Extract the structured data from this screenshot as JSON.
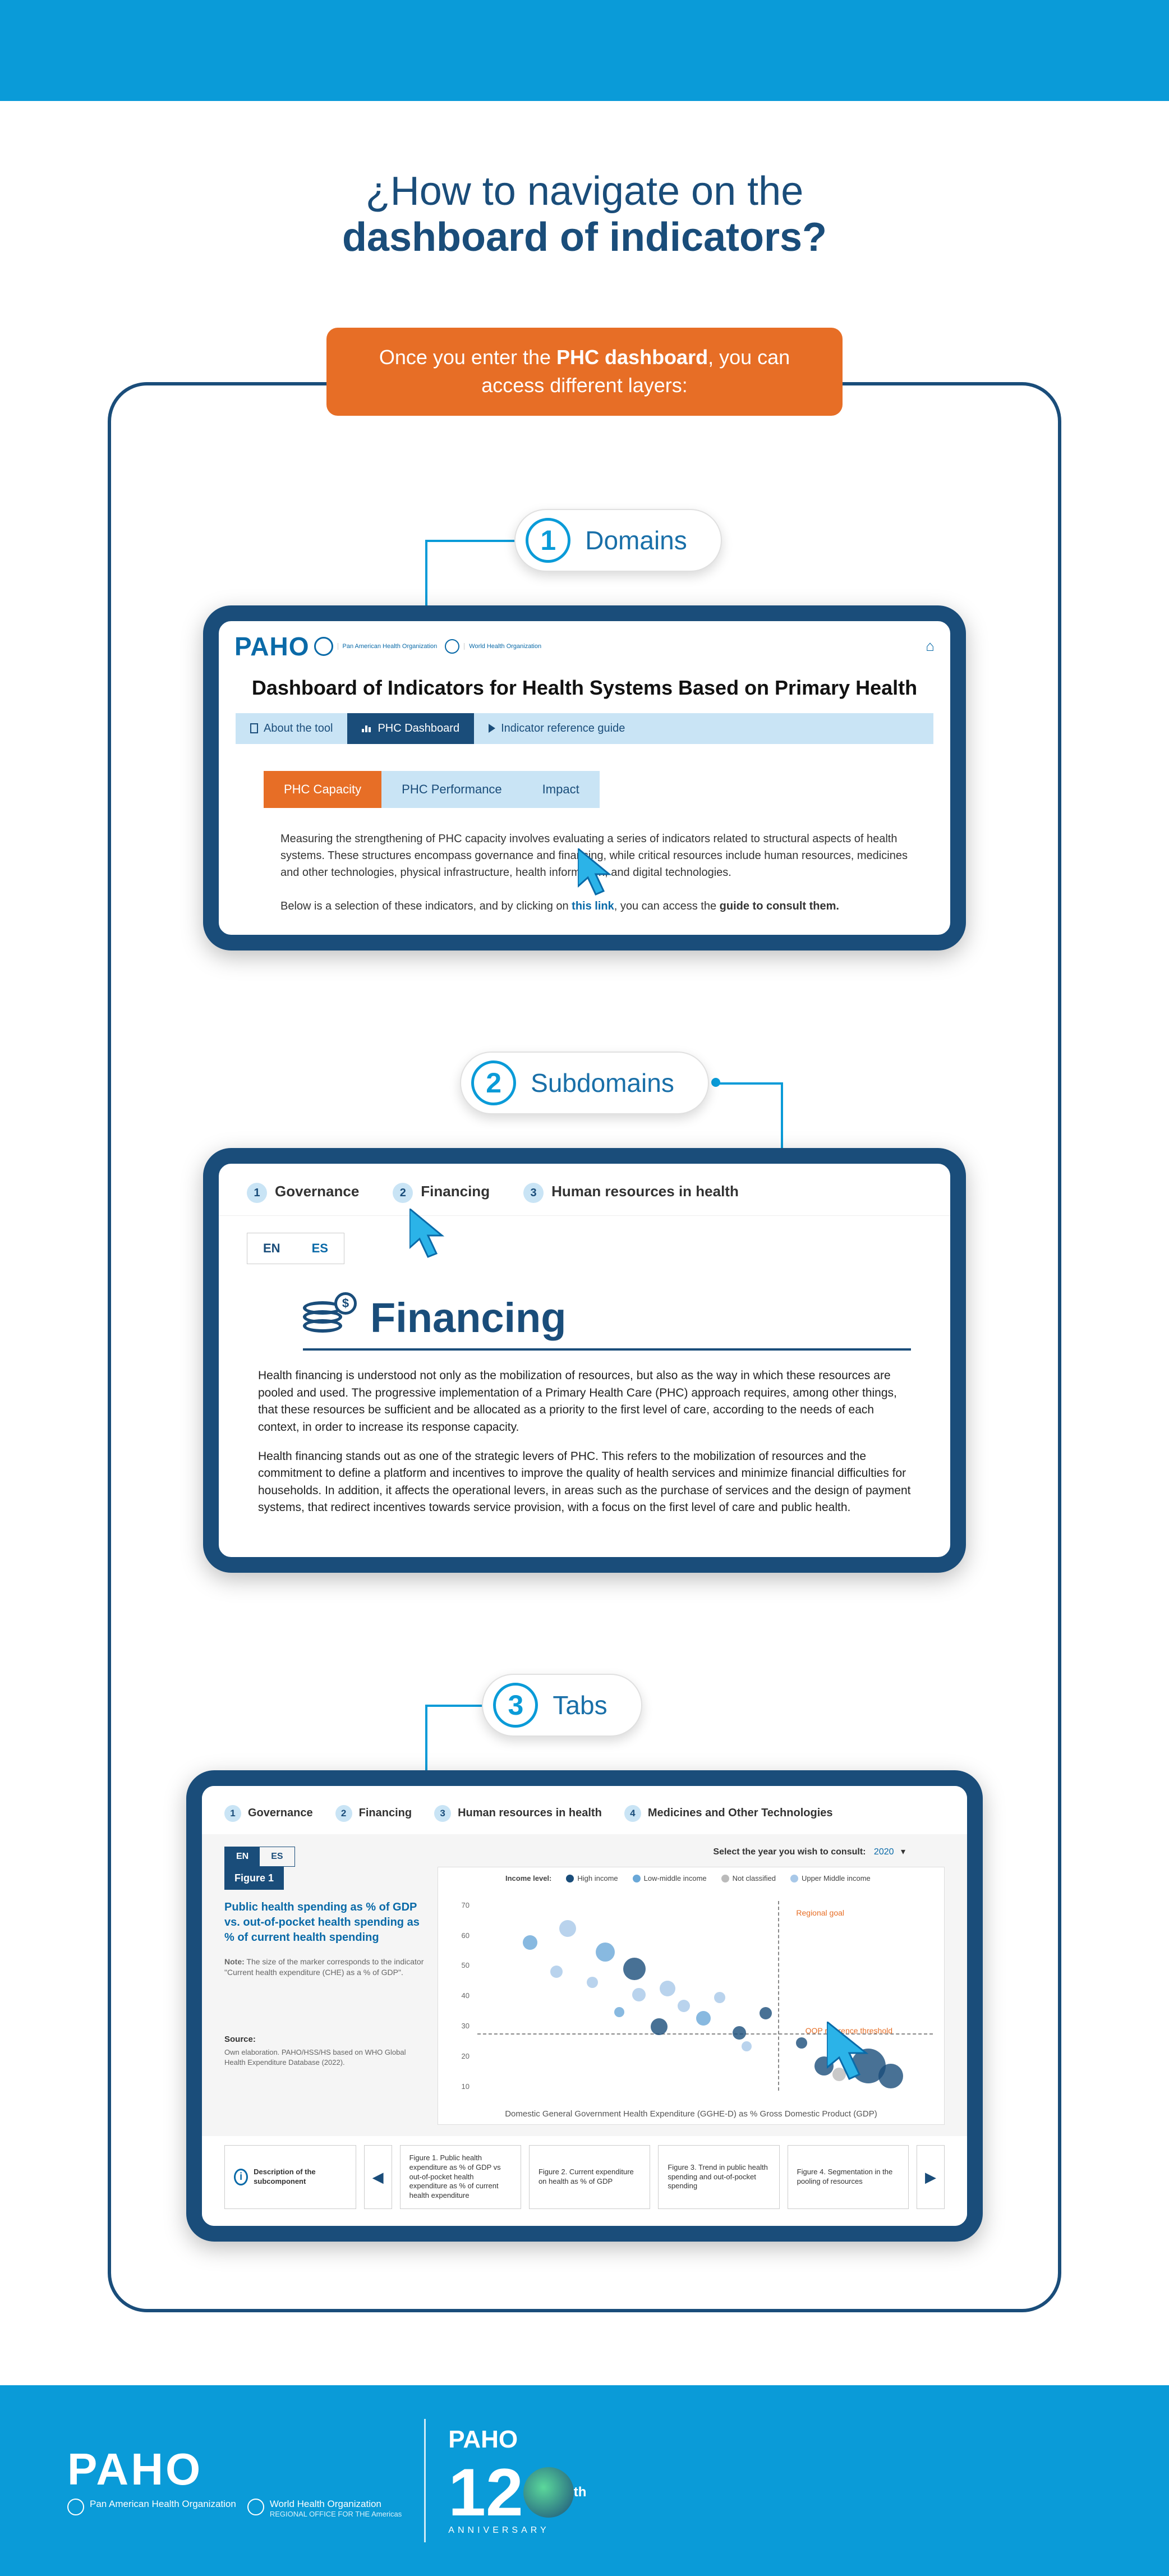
{
  "title": {
    "line1": "¿How to navigate on the",
    "line2": "dashboard of indicators?"
  },
  "intro": {
    "prefix": "Once you enter the ",
    "bold": "PHC dashboard",
    "suffix": ", you can access different layers:"
  },
  "steps": {
    "s1": {
      "num": "1",
      "label": "Domains"
    },
    "s2": {
      "num": "2",
      "label": "Subdomains"
    },
    "s3": {
      "num": "3",
      "label": "Tabs"
    }
  },
  "ss1": {
    "logo_word": "PAHO",
    "logo_sub1": "Pan American Health Organization",
    "logo_sub2": "World Health Organization",
    "title": "Dashboard of Indicators for Health Systems Based on Primary Health",
    "tab_about": "About the tool",
    "tab_dash": "PHC Dashboard",
    "tab_ref": "Indicator reference guide",
    "pill_capacity": "PHC Capacity",
    "pill_perf": "PHC Performance",
    "pill_impact": "Impact",
    "para1": "Measuring the strengthening of PHC capacity involves evaluating a series of indicators related to structural aspects of health systems. These structures encompass governance and financing, while critical resources include human resources, medicines and other technologies, physical infrastructure, health information, and digital technologies.",
    "para2_pre": "Below is a selection of these indicators, and by clicking on ",
    "para2_link": "this link",
    "para2_mid": ", you can access the ",
    "para2_bold": "guide to consult them."
  },
  "ss2": {
    "sub1": "Governance",
    "sub2": "Financing",
    "sub3": "Human resources in health",
    "lang_en": "EN",
    "lang_es": "ES",
    "heading": "Financing",
    "p1": "Health financing is understood not only as the mobilization of resources, but also as the way in which these resources are pooled and used. The progressive implementation of a Primary Health Care (PHC) approach requires, among other things, that these resources be sufficient and be allocated as a priority to the first level of care, according to the needs of each context, in order to increase its response capacity.",
    "p2": "Health financing stands out as one of the strategic levers of PHC. This refers to the mobilization of resources and the commitment to define a platform and incentives to improve the quality of health services and minimize financial difficulties for households. In addition, it affects the operational levers, in areas such as the purchase of services and the design of payment systems, that redirect incentives towards service provision, with a focus on the first level of care and public health."
  },
  "ss3": {
    "sub1": "Governance",
    "sub2": "Financing",
    "sub3": "Human resources in health",
    "sub4": "Medicines and Other Technologies",
    "lang_en": "EN",
    "lang_es": "ES",
    "year_label": "Select the year you wish to consult:",
    "year": "2020",
    "fig_label": "Figure 1",
    "fig_title": "Public health spending as % of GDP vs. out-of-pocket health spending as % of current health spending",
    "note_label": "Note:",
    "note": "The size of the marker corresponds to the indicator \"Current health expenditure (CHE) as a % of GDP\".",
    "source_h": "Source:",
    "source": "Own elaboration. PAHO/HSS/HS based on WHO Global Health Expenditure Database (2022).",
    "legend_label": "Income level:",
    "leg1": "High income",
    "leg2": "Low-middle income",
    "leg3": "Not classified",
    "leg4": "Upper Middle income",
    "ann_goal": "Regional goal",
    "ann_ref": "OOP reference threshold",
    "x_label": "Domestic General Government Health Expenditure (GGHE-D) as % Gross Domestic Product (GDP)",
    "y_ticks": [
      "70",
      "60",
      "50",
      "40",
      "30",
      "20",
      "10"
    ],
    "card_desc": "Description of the subcomponent",
    "card1": "Figure 1. Public health expenditure as % of GDP vs out-of-pocket health expenditure as % of current health expenditure",
    "card2": "Figure 2. Current expenditure on health as % of GDP",
    "card3": "Figure 3. Trend in public health spending and out-of-pocket spending",
    "card4": "Figure 4. Segmentation in the pooling of resources"
  },
  "footer": {
    "paho": "PAHO",
    "org1": "Pan American Health Organization",
    "org2": "World Health Organization",
    "region": "REGIONAL OFFICE FOR THE Americas",
    "anniv_p": "PAHO",
    "anniv_num_1": "1",
    "anniv_num_2": "2",
    "anniv_th": "th",
    "anniv_label": "ANNIVERSARY"
  },
  "colors": {
    "brand_blue": "#0a9bd8",
    "dark_blue": "#1a4d7a",
    "orange": "#e76e26"
  }
}
